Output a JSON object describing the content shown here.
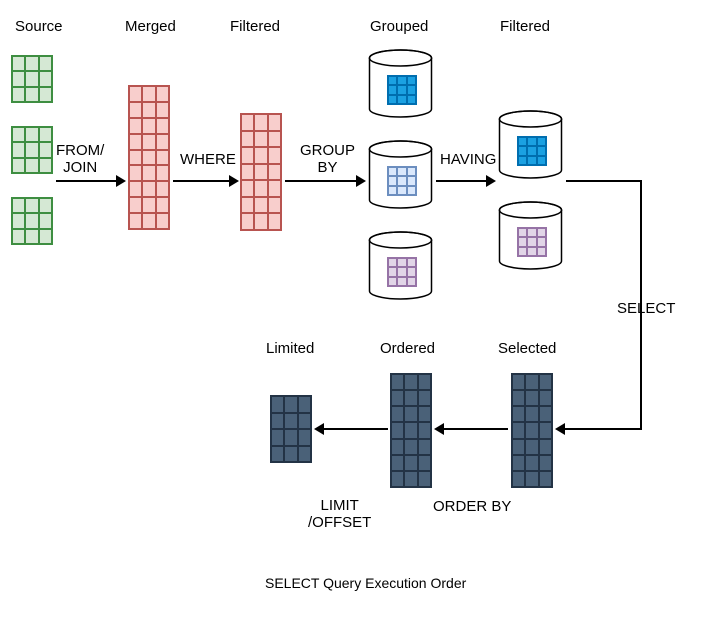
{
  "stages": {
    "source": "Source",
    "merged": "Merged",
    "filtered1": "Filtered",
    "grouped": "Grouped",
    "filtered2": "Filtered",
    "selected": "Selected",
    "ordered": "Ordered",
    "limited": "Limited"
  },
  "operations": {
    "from_join": "FROM/\nJOIN",
    "where": "WHERE",
    "group_by": "GROUP\nBY",
    "having": "HAVING",
    "select": "SELECT",
    "order_by": "ORDER BY",
    "limit_offset": "LIMIT\n/OFFSET"
  },
  "title": "SELECT Query Execution Order",
  "colors": {
    "green_fill": "#d5e8d4",
    "green_border": "#3e8e41",
    "red_fill": "#f8cecc",
    "red_border": "#b85450",
    "cyan_fill": "#1ba1e2",
    "cyan_border": "#006eaf",
    "lightblue_fill": "#dae8fc",
    "lightblue_border": "#6c8ebf",
    "purple_fill": "#e1d5e7",
    "purple_border": "#9673a6",
    "darkblue_fill": "#4a6178",
    "darkblue_border": "#233345"
  }
}
